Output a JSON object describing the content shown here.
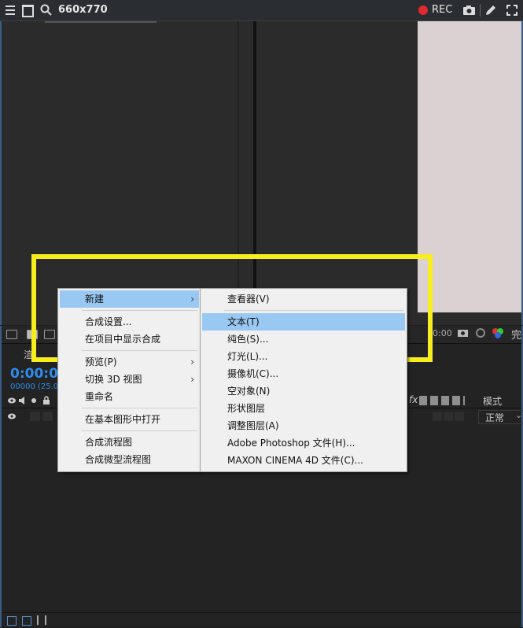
{
  "titlebar": {
    "size_label": "660x770",
    "rec_label": "REC",
    "icons": [
      "hamburger-icon",
      "window-icon",
      "search-icon",
      "record-icon",
      "camera-icon",
      "pen-icon",
      "fullscreen-icon"
    ]
  },
  "timeline": {
    "time_code": "0:00:00",
    "frame_info": "00000 (25.00",
    "tab_partial": "渲",
    "fx_label": "fx",
    "mode_header": "模式",
    "mode_value": "正常",
    "right_time": "0:00",
    "done_partial": "完"
  },
  "context_menu": {
    "items": [
      {
        "label": "新建",
        "submenu": true,
        "highlighted": true
      },
      {
        "label": "合成设置...",
        "submenu": false
      },
      {
        "label": "在项目中显示合成",
        "submenu": false
      },
      {
        "label": "预览(P)",
        "submenu": true
      },
      {
        "label": "切换 3D 视图",
        "submenu": true
      },
      {
        "label": "重命名",
        "submenu": false
      },
      {
        "label": "在基本图形中打开",
        "submenu": false
      },
      {
        "label": "合成流程图",
        "submenu": false
      },
      {
        "label": "合成微型流程图",
        "submenu": false
      }
    ],
    "arrow": "›"
  },
  "submenu": {
    "items": [
      {
        "label": "查看器(V)"
      },
      {
        "label": "文本(T)",
        "highlighted": true
      },
      {
        "label": "纯色(S)..."
      },
      {
        "label": "灯光(L)..."
      },
      {
        "label": "摄像机(C)..."
      },
      {
        "label": "空对象(N)"
      },
      {
        "label": "形状图层"
      },
      {
        "label": "调整图层(A)"
      },
      {
        "label": "Adobe Photoshop 文件(H)..."
      },
      {
        "label": "MAXON CINEMA 4D 文件(C)..."
      }
    ]
  },
  "colors": {
    "highlight_box": "#f7ee1c",
    "menu_highlight": "#99c9f3",
    "rec_red": "#e0282e",
    "timecode_blue": "#2d8ceb"
  }
}
